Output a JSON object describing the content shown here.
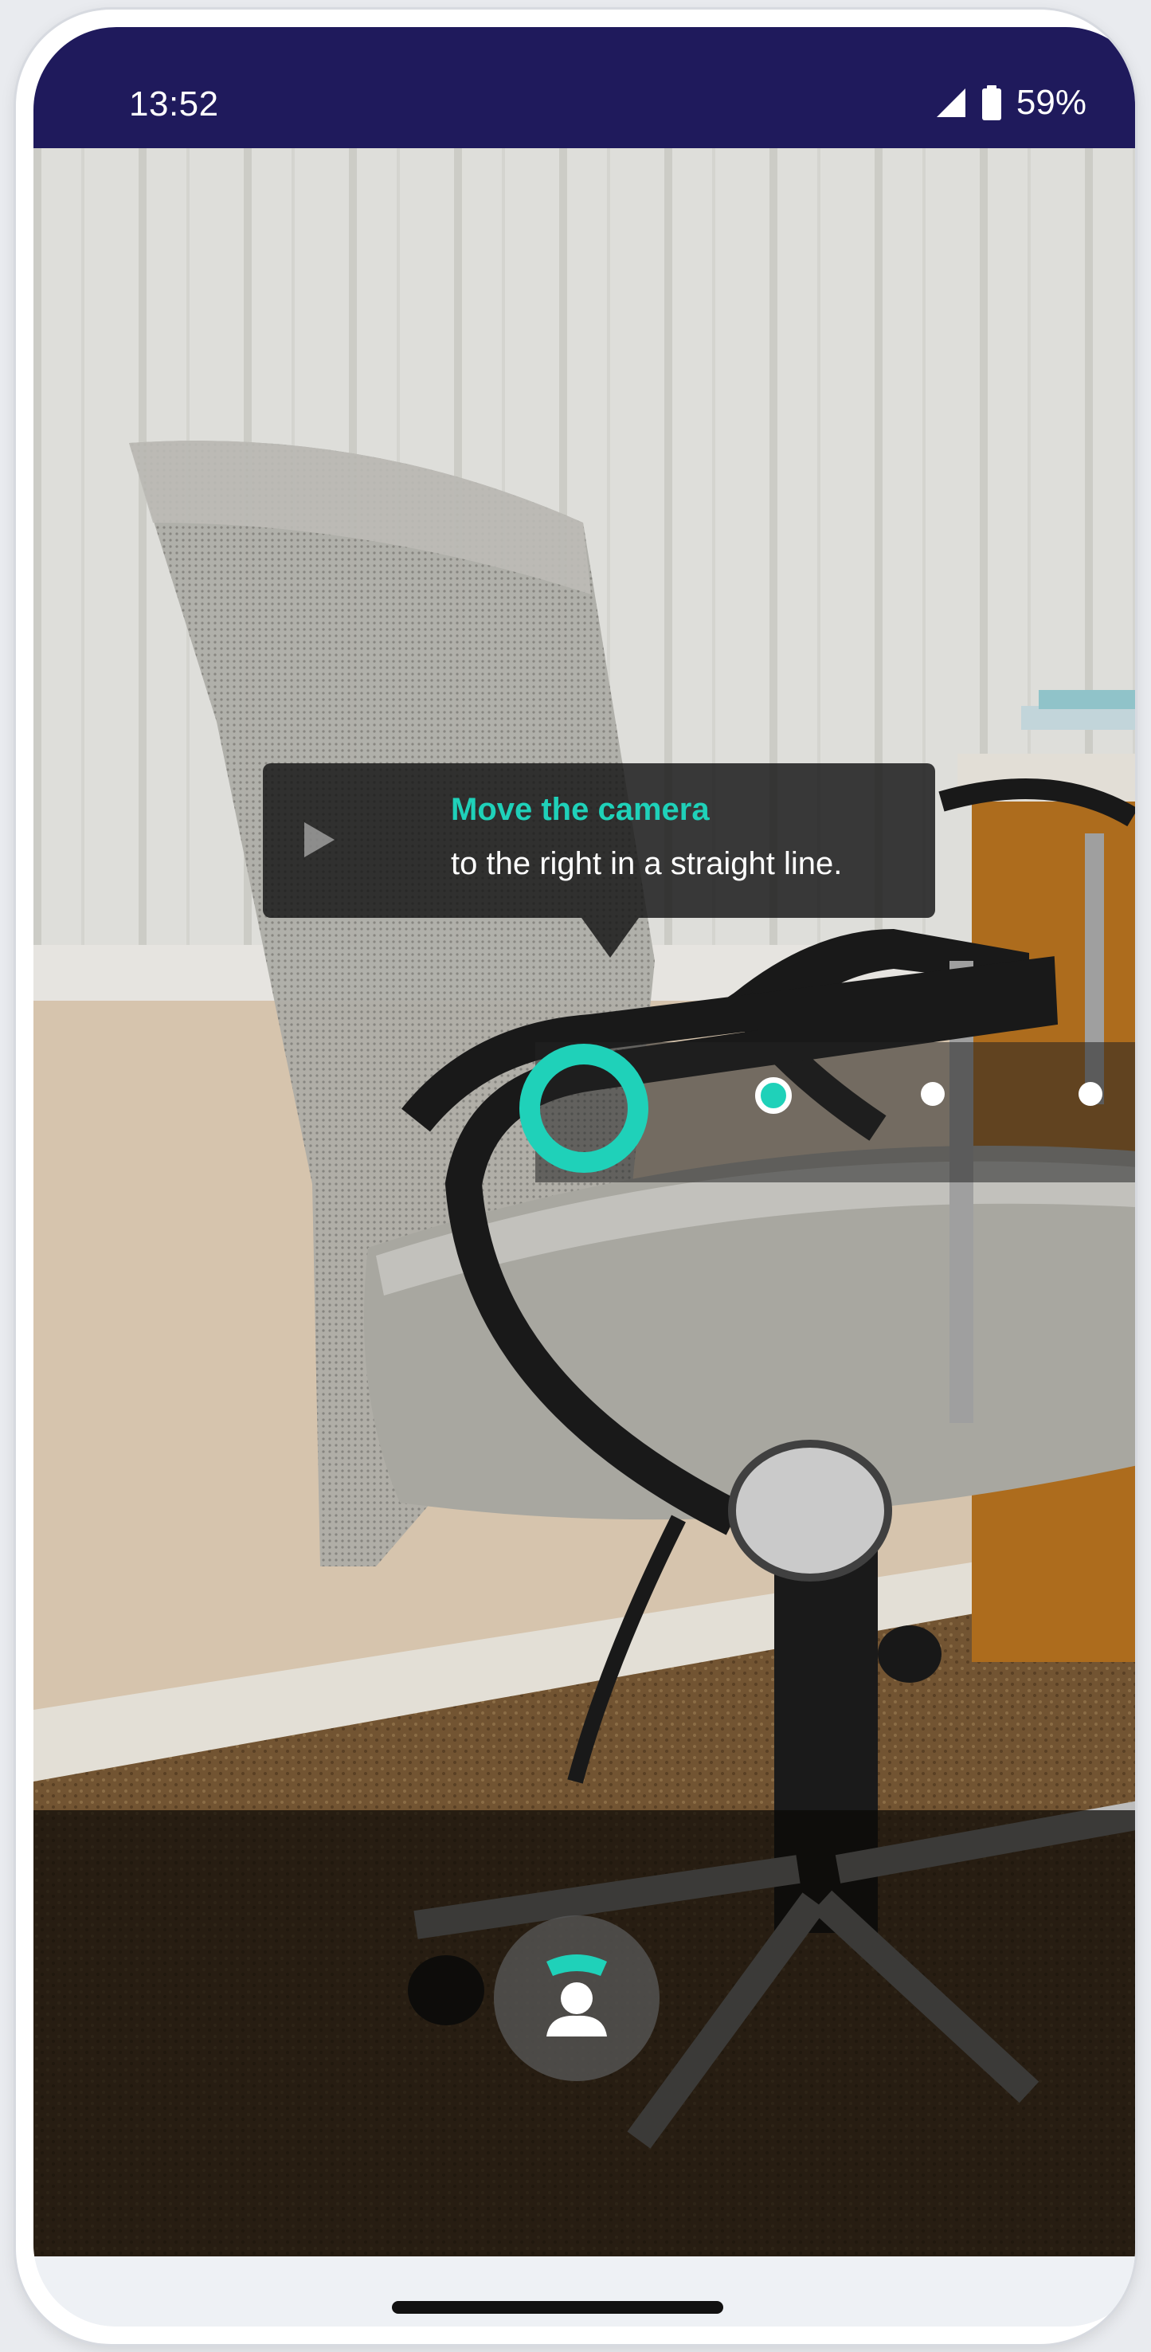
{
  "status_bar": {
    "time": "13:52",
    "battery": "59%",
    "icons": [
      "signal-icon",
      "battery-icon"
    ]
  },
  "guide": {
    "title": "Move the camera",
    "instruction": "to the right in a straight line.",
    "icon": "play-arrow-icon"
  },
  "progress": {
    "steps_total": 4,
    "current_step": 1,
    "icons": [
      "progress-ring-icon",
      "progress-dot-next",
      "progress-dot",
      "progress-dot"
    ]
  },
  "capture": {
    "icon": "panorama-capture-icon"
  },
  "colors": {
    "status_bar": "#1f1a5c",
    "accent": "#1fd1b9",
    "overlay": "#141414"
  }
}
